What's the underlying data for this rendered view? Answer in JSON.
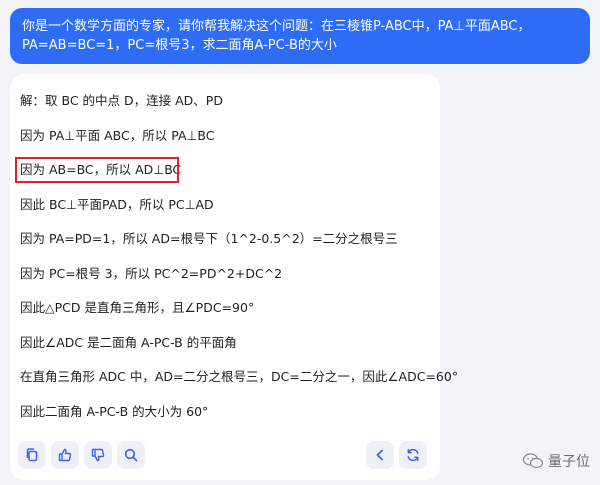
{
  "user_message": "你是一个数学方面的专家，请你帮我解决这个问题：在三棱锥P-ABC中，PA⊥平面ABC，PA=AB=BC=1，PC=根号3，求二面角A-PC-B的大小",
  "answer": {
    "lines": [
      "解：取 BC 的中点 D，连接 AD、PD",
      "因为 PA⊥平面 ABC，所以 PA⊥BC",
      "因为 AB=BC，所以 AD⊥BC",
      "因此 BC⊥平面PAD，所以 PC⊥AD",
      "因为 PA=PD=1，所以 AD=根号下（1^2-0.5^2）=二分之根号三",
      "因为 PC=根号 3，所以 PC^2=PD^2+DC^2",
      "因此△PCD 是直角三角形，且∠PDC=90°",
      "因此∠ADC 是二面角 A-PC-B 的平面角",
      "在直角三角形 ADC 中，AD=二分之根号三，DC=二分之一，因此∠ADC=60°",
      "因此二面角 A-PC-B 的大小为 60°"
    ]
  },
  "toolbar": {
    "icons": [
      "copy-icon",
      "thumbs-up-icon",
      "thumbs-down-icon",
      "search-icon",
      "chevron-left-icon",
      "refresh-icon"
    ]
  },
  "watermark": {
    "text": "量子位"
  },
  "colors": {
    "accent": "#2f6cf6",
    "highlight": "#e3202c",
    "icon": "#3c62e8",
    "icon_bg": "#eef0f8"
  }
}
